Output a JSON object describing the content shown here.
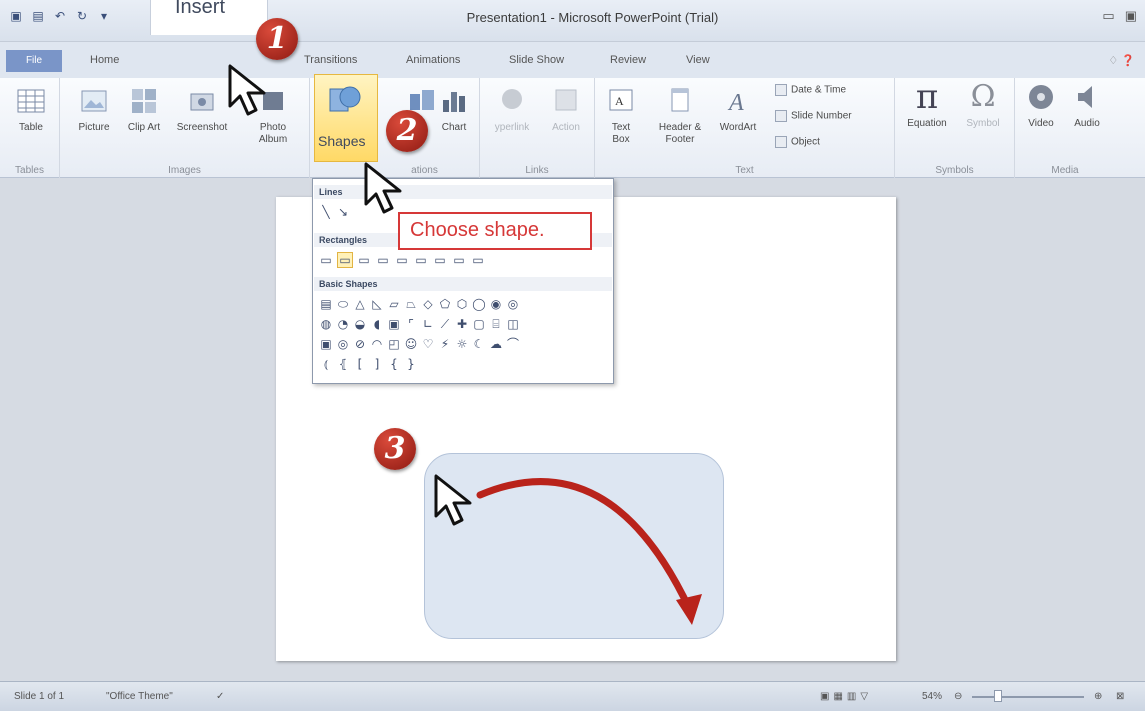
{
  "window": {
    "title": "Presentation1 - Microsoft PowerPoint (Trial)"
  },
  "tabs": {
    "file": "File",
    "home": "Home",
    "insert": "Insert",
    "transitions": "Transitions",
    "animations": "Animations",
    "slide_show": "Slide Show",
    "review": "Review",
    "view": "View"
  },
  "ribbon": {
    "tables": {
      "label": "Tables",
      "table": "Table"
    },
    "images": {
      "label": "Images",
      "picture": "Picture",
      "clip_art": "Clip Art",
      "screenshot": "Screenshot",
      "photo_album": "Photo Album"
    },
    "illustrations": {
      "label": "ations",
      "shapes": "Shapes",
      "chart": "Chart"
    },
    "links": {
      "label": "Links",
      "hyperlink": "yperlink",
      "action": "Action"
    },
    "text": {
      "label": "Text",
      "text_box": "Text Box",
      "header_footer": "Header & Footer",
      "wordart": "WordArt",
      "date_time": "Date & Time",
      "slide_number": "Slide Number",
      "object": "Object"
    },
    "symbols": {
      "label": "Symbols",
      "equation": "Equation",
      "symbol": "Symbol"
    },
    "media": {
      "label": "Media",
      "video": "Video",
      "audio": "Audio"
    }
  },
  "dropdown": {
    "lines": "Lines",
    "rectangles": "Rectangles",
    "basic_shapes": "Basic Shapes"
  },
  "callout": "Choose shape.",
  "steps": [
    "1",
    "2",
    "3"
  ],
  "status": {
    "slide": "Slide 1 of 1",
    "theme": "\"Office Theme\"",
    "zoom": "54%"
  }
}
